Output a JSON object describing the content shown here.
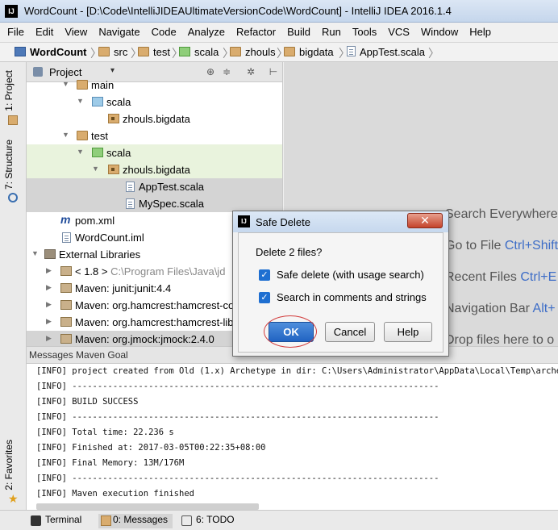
{
  "window": {
    "title": "WordCount - [D:\\Code\\IntelliJIDEAUltimateVersionCode\\WordCount] - IntelliJ IDEA 2016.1.4",
    "app_icon": "IJ"
  },
  "menu": [
    "File",
    "Edit",
    "View",
    "Navigate",
    "Code",
    "Analyze",
    "Refactor",
    "Build",
    "Run",
    "Tools",
    "VCS",
    "Window",
    "Help"
  ],
  "breadcrumb": [
    "WordCount",
    "src",
    "test",
    "scala",
    "zhouls",
    "bigdata",
    "AppTest.scala"
  ],
  "left_strip": {
    "project_tab": "1: Project",
    "structure_tab": "7: Structure",
    "favorites_tab": "2: Favorites"
  },
  "project_panel": {
    "view_selector": "Project",
    "tree": [
      {
        "label": "main",
        "icon": "folder-icon",
        "expanded": true
      },
      {
        "label": "scala",
        "icon": "source-folder-icon",
        "expanded": true
      },
      {
        "label": "zhouls.bigdata",
        "icon": "package-icon"
      },
      {
        "label": "test",
        "icon": "folder-icon",
        "expanded": true
      },
      {
        "label": "scala",
        "icon": "test-folder-icon",
        "expanded": true
      },
      {
        "label": "zhouls.bigdata",
        "icon": "package-icon",
        "expanded": true
      },
      {
        "label": "AppTest.scala",
        "icon": "scala-file-icon"
      },
      {
        "label": "MySpec.scala",
        "icon": "scala-file-icon"
      },
      {
        "label": "pom.xml",
        "icon": "maven-icon"
      },
      {
        "label": "WordCount.iml",
        "icon": "file-icon"
      },
      {
        "label": "External Libraries",
        "icon": "library-icon",
        "expanded": true
      },
      {
        "label": "< 1.8 >",
        "extra": "C:\\Program Files\\Java\\jd",
        "icon": "jdk-icon"
      },
      {
        "label": "Maven: junit:junit:4.4",
        "icon": "jar-icon"
      },
      {
        "label": "Maven: org.hamcrest:hamcrest-co",
        "icon": "jar-icon"
      },
      {
        "label": "Maven: org.hamcrest:hamcrest-lib",
        "icon": "jar-icon"
      },
      {
        "label": "Maven: org.jmock:jmock:2.4.0",
        "icon": "jar-icon"
      }
    ]
  },
  "editor_hints": [
    {
      "text": "Search Everywhere",
      "key": ""
    },
    {
      "text": "Go to File",
      "key": "Ctrl+Shift"
    },
    {
      "text": "Recent Files",
      "key": "Ctrl+E"
    },
    {
      "text": "Navigation Bar",
      "key": "Alt+"
    },
    {
      "text": "Drop files here to o",
      "key": ""
    }
  ],
  "messages_panel": {
    "header": "Messages Maven Goal",
    "lines": [
      "[INFO] project created from Old (1.x) Archetype in dir: C:\\Users\\Administrator\\AppData\\Local\\Temp\\archetypetm",
      "[INFO] ------------------------------------------------------------------------",
      "[INFO] BUILD SUCCESS",
      "[INFO] ------------------------------------------------------------------------",
      "[INFO] Total time: 22.236 s",
      "[INFO] Finished at: 2017-03-05T00:22:35+08:00",
      "[INFO] Final Memory: 13M/176M",
      "[INFO] ------------------------------------------------------------------------",
      "[INFO] Maven execution finished"
    ]
  },
  "bottom_tabs": [
    "Terminal",
    "0: Messages",
    "6: TODO"
  ],
  "dialog": {
    "title": "Safe Delete",
    "question": "Delete 2 files?",
    "options": [
      {
        "label": "Safe delete (with usage search)",
        "checked": true
      },
      {
        "label": "Search in comments and strings",
        "checked": true
      }
    ],
    "buttons": {
      "ok": "OK",
      "cancel": "Cancel",
      "help": "Help"
    }
  },
  "colors": {
    "accent": "#2163c2",
    "annotation": "#d23c3c",
    "hint_key": "#3d6dc7"
  }
}
